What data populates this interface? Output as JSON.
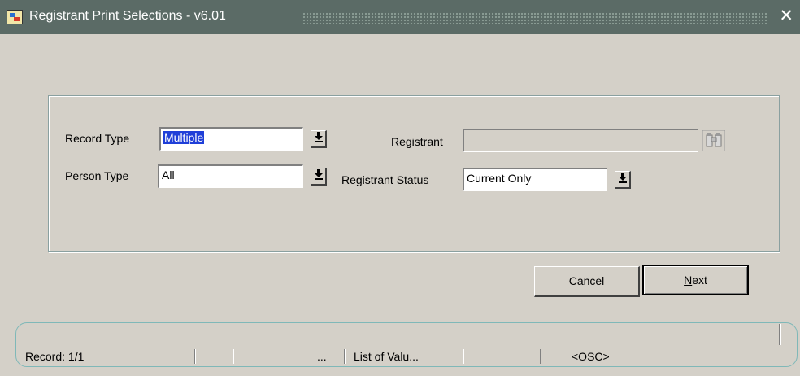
{
  "window": {
    "title": "Registrant Print Selections - v6.01",
    "close_glyph": "✕"
  },
  "form": {
    "record_type": {
      "label": "Record Type",
      "value": "Multiple"
    },
    "person_type": {
      "label": "Person Type",
      "value": "All"
    },
    "registrant": {
      "label": "Registrant",
      "value": ""
    },
    "registrant_status": {
      "label": "Registrant Status",
      "value": "Current Only"
    }
  },
  "icons": {
    "dropdown": "download-arrow-icon",
    "lov": "binoculars-icon"
  },
  "buttons": {
    "cancel": "Cancel",
    "next_mnemonic": "N",
    "next_rest": "ext"
  },
  "status": {
    "record": "Record: 1/1",
    "ellipsis": "...",
    "lov": "List of Valu...",
    "osc": "<OSC>"
  },
  "colors": {
    "titlebar": "#5b6b66",
    "selection": "#1f3fd8",
    "background": "#d4d0c8"
  }
}
